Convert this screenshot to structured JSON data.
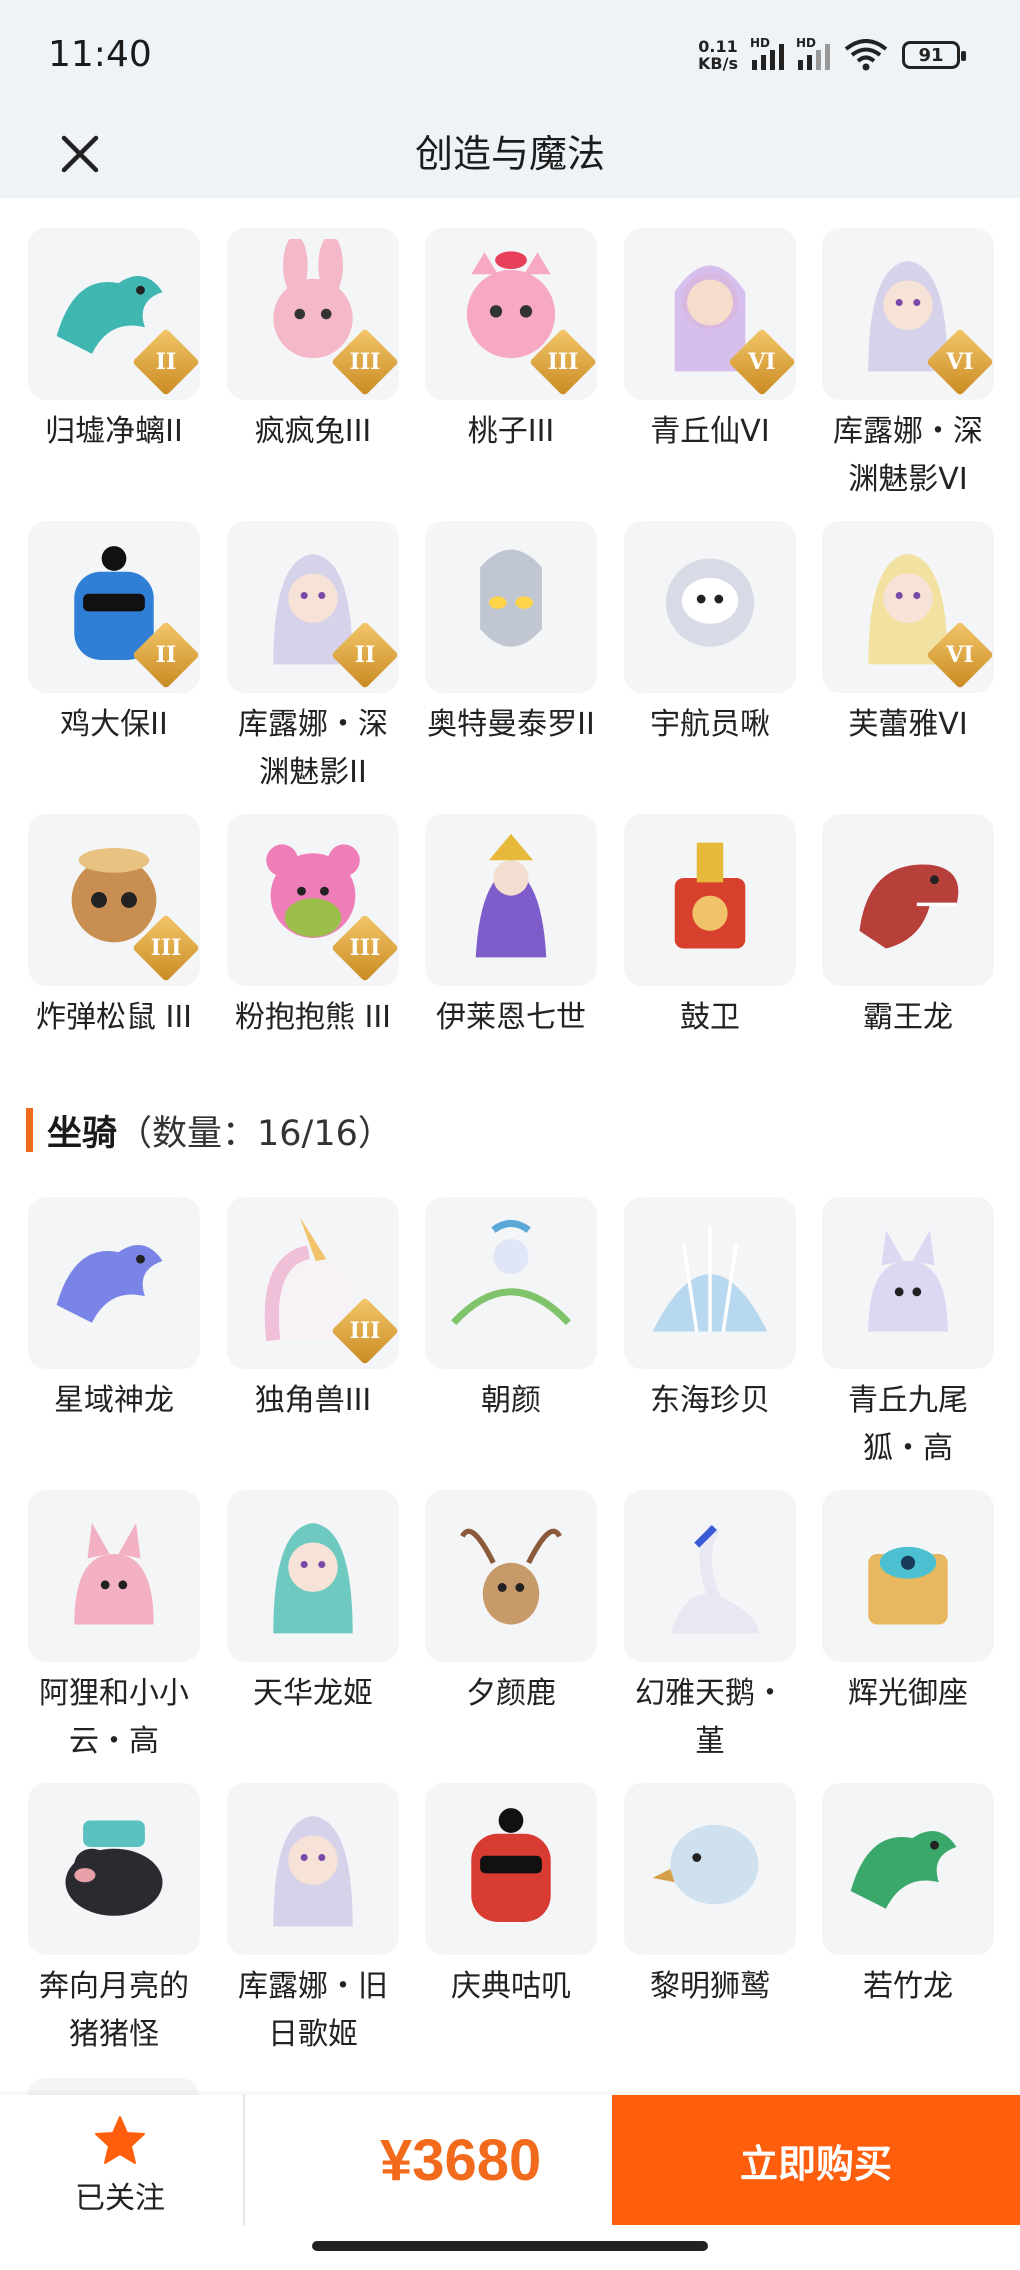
{
  "status_bar": {
    "time": "11:40",
    "net_speed_value": "0.11",
    "net_speed_unit": "KB/s",
    "signal_label": "HD",
    "wifi_label": "6",
    "battery": "91"
  },
  "header": {
    "title": "创造与魔法",
    "close_icon": "close-icon"
  },
  "section_top": {
    "items": [
      {
        "label": "归墟净螭II",
        "badge": "II",
        "color": "#3fb7b0",
        "icon": "dragon"
      },
      {
        "label": "疯疯兔III",
        "badge": "III",
        "color": "#f4b8c8",
        "icon": "rabbit"
      },
      {
        "label": "桃子III",
        "badge": "III",
        "color": "#f7a9c4",
        "icon": "cat"
      },
      {
        "label": "青丘仙VI",
        "badge": "VI",
        "color": "#c9a8e8",
        "icon": "fox-girl"
      },
      {
        "label": "库露娜・深渊魅影VI",
        "badge": "VI",
        "color": "#d6d2ea",
        "icon": "girl"
      },
      {
        "label": "鸡大保II",
        "badge": "II",
        "color": "#2f7fd6",
        "icon": "bird"
      },
      {
        "label": "库露娜・深渊魅影II",
        "badge": "II",
        "color": "#d6d2ea",
        "icon": "girl"
      },
      {
        "label": "奥特曼泰罗II",
        "badge": "",
        "color": "#c0c6d2",
        "icon": "hero"
      },
      {
        "label": "宇航员啾",
        "badge": "",
        "color": "#d8dbe6",
        "icon": "astronaut"
      },
      {
        "label": "芙蕾雅VI",
        "badge": "VI",
        "color": "#f2e1a0",
        "icon": "girl"
      },
      {
        "label": "炸弹松鼠 III",
        "badge": "III",
        "color": "#c98f52",
        "icon": "squirrel"
      },
      {
        "label": "粉抱抱熊 III",
        "badge": "III",
        "color": "#ee7db8",
        "icon": "bear"
      },
      {
        "label": "伊莱恩七世",
        "badge": "",
        "color": "#7e5cc9",
        "icon": "queen"
      },
      {
        "label": "鼓卫",
        "badge": "",
        "color": "#d6402c",
        "icon": "drum"
      },
      {
        "label": "霸王龙",
        "badge": "",
        "color": "#b8403a",
        "icon": "trex"
      }
    ]
  },
  "section_mounts": {
    "title": "坐骑",
    "count": "（数量：16/16）",
    "items": [
      {
        "label": "星域神龙",
        "badge": "",
        "color": "#7a84e6",
        "icon": "dragon"
      },
      {
        "label": "独角兽III",
        "badge": "III",
        "color": "#f0c0d8",
        "icon": "unicorn"
      },
      {
        "label": "朝颜",
        "badge": "",
        "color": "#7fc36b",
        "icon": "vine"
      },
      {
        "label": "东海珍贝",
        "badge": "",
        "color": "#b8d8f0",
        "icon": "shell"
      },
      {
        "label": "青丘九尾狐・高",
        "badge": "",
        "color": "#dcd8f2",
        "icon": "fox"
      },
      {
        "label": "阿狸和小小云・高",
        "badge": "",
        "color": "#f3b0c2",
        "icon": "fox"
      },
      {
        "label": "天华龙姬",
        "badge": "",
        "color": "#6ec9c0",
        "icon": "girl"
      },
      {
        "label": "夕颜鹿",
        "badge": "",
        "color": "#c79a6a",
        "icon": "deer"
      },
      {
        "label": "幻雅天鹅・堇",
        "badge": "",
        "color": "#e8e8f2",
        "icon": "swan"
      },
      {
        "label": "辉光御座",
        "badge": "",
        "color": "#e8b860",
        "icon": "throne"
      },
      {
        "label": "奔向月亮的猪猪怪",
        "badge": "",
        "color": "#2a2a30",
        "icon": "pig"
      },
      {
        "label": "库露娜・旧日歌姬",
        "badge": "",
        "color": "#d6d2ea",
        "icon": "girl"
      },
      {
        "label": "庆典咕叽",
        "badge": "",
        "color": "#d83b32",
        "icon": "bird"
      },
      {
        "label": "黎明狮鹫",
        "badge": "",
        "color": "#cfe0ee",
        "icon": "griffin"
      },
      {
        "label": "若竹龙",
        "badge": "",
        "color": "#3aa86a",
        "icon": "dragon"
      }
    ]
  },
  "bottom_bar": {
    "follow_label": "已关注",
    "price": "¥3680",
    "buy_label": "立即购买"
  },
  "colors": {
    "accent": "#ff5f0c",
    "price": "#f26a1b",
    "header_bg": "#eef3f7",
    "tile_bg": "#f4f5f7"
  }
}
